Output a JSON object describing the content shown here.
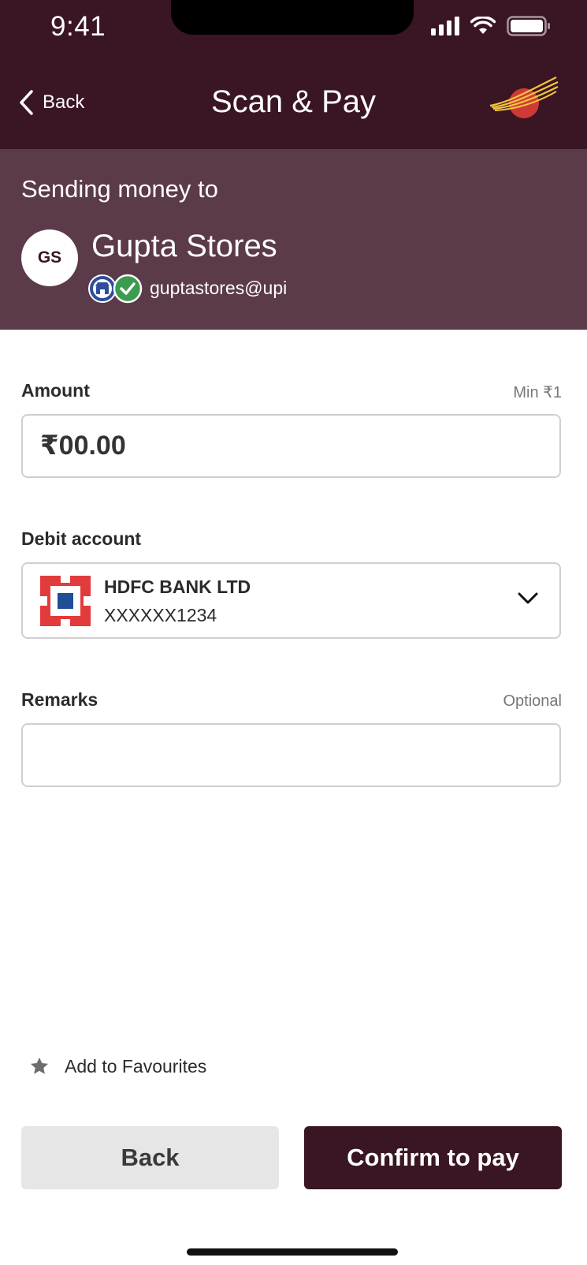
{
  "status_bar": {
    "time": "9:41",
    "icons": [
      "cellular-signal-icon",
      "wifi-icon",
      "battery-icon"
    ]
  },
  "header": {
    "back_label": "Back",
    "title": "Scan & Pay",
    "logo": "india-post-logo"
  },
  "recipient": {
    "label": "Sending money to",
    "initials": "GS",
    "name": "Gupta Stores",
    "upi_id": "guptastores@upi",
    "badges": [
      "merchant-badge-icon",
      "verified-check-icon"
    ]
  },
  "amount": {
    "label": "Amount",
    "hint": "Min ₹1",
    "placeholder": "₹00.00",
    "value": ""
  },
  "debit_account": {
    "label": "Debit account",
    "bank_name": "HDFC BANK LTD",
    "account_number": "XXXXXX1234",
    "bank_logo": "hdfc-bank-logo"
  },
  "remarks": {
    "label": "Remarks",
    "hint": "Optional",
    "value": ""
  },
  "favourites": {
    "label": "Add to Favourites"
  },
  "actions": {
    "back_label": "Back",
    "confirm_label": "Confirm to pay"
  },
  "colors": {
    "header_bg": "#3a1524",
    "banner_bg": "#5b3a4a",
    "primary_button": "#3a1524",
    "secondary_button": "#e6e6e6",
    "hdfc_red": "#e23b3b",
    "hdfc_blue": "#1d4e96",
    "verified_green": "#3b9b4f",
    "logo_red": "#cf3a36",
    "logo_yellow": "#f2c53d"
  }
}
